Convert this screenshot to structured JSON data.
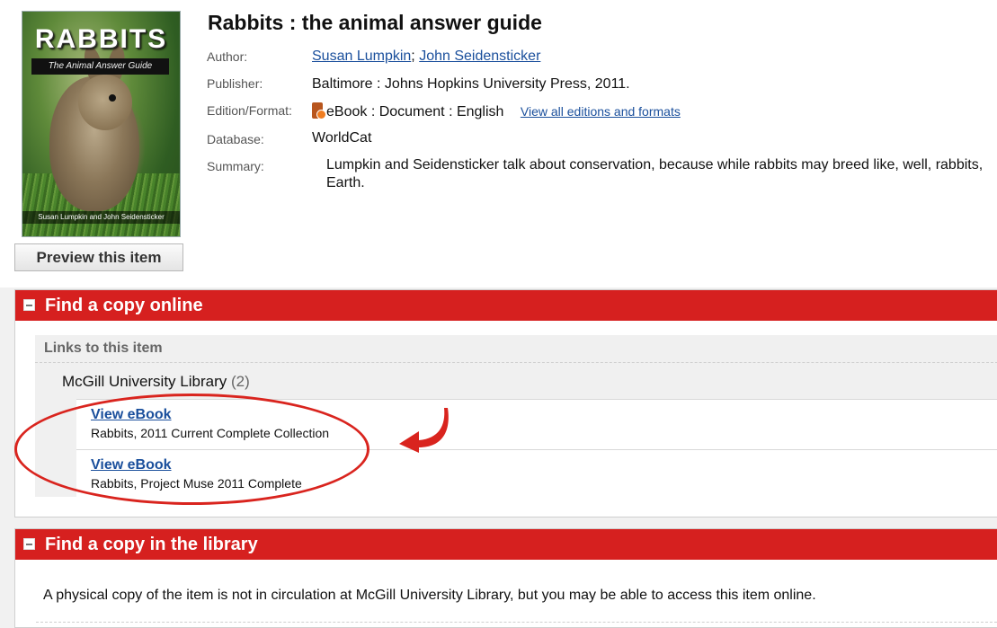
{
  "cover": {
    "title": "RABBITS",
    "subtitle": "The Animal Answer Guide",
    "authors": "Susan Lumpkin and John Seidensticker"
  },
  "preview_button": "Preview this item",
  "item": {
    "title": "Rabbits : the animal answer guide",
    "author_label": "Author:",
    "authors": [
      "Susan Lumpkin",
      "John Seidensticker"
    ],
    "author_separator": ";",
    "publisher_label": "Publisher:",
    "publisher": "Baltimore : Johns Hopkins University Press, 2011.",
    "edition_label": "Edition/Format:",
    "edition": "eBook : Document : English",
    "edition_link": "View all editions and formats",
    "database_label": "Database:",
    "database": "WorldCat",
    "summary_label": "Summary:",
    "summary_line1": "Lumpkin and Seidensticker talk about conservation, because while rabbits may breed like, well, rabbits,",
    "summary_line2": "Earth."
  },
  "online_section": {
    "title": "Find a copy online",
    "links_heading": "Links to this item",
    "library": "McGill University Library",
    "library_count": "(2)",
    "links": [
      {
        "label": "View eBook",
        "source": "Rabbits, 2011 Current Complete Collection"
      },
      {
        "label": "View eBook",
        "source": "Rabbits, Project Muse 2011 Complete"
      }
    ]
  },
  "library_section": {
    "title": "Find a copy in the library",
    "notice": "A physical copy of the item is not in circulation at McGill University Library, but you may be able to access this item online."
  },
  "colors": {
    "header_red": "#d6201f",
    "link_blue": "#1a4f9c",
    "annotation_red": "#d9241e"
  }
}
